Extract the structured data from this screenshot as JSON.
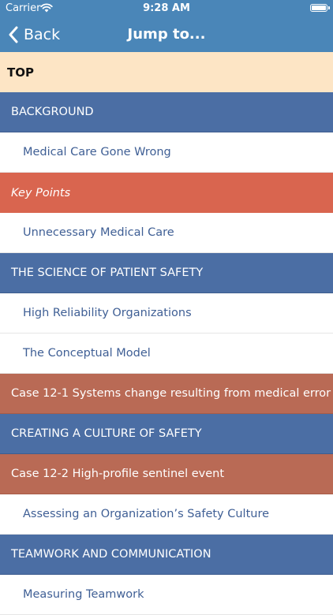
{
  "status_bar": {
    "carrier": "Carrier",
    "time": "9:28 AM",
    "wifi_icon": "wifi-icon",
    "battery_icon": "battery-icon"
  },
  "nav": {
    "back_label": "Back",
    "title": "Jump to...",
    "back_icon": "chevron-left-icon"
  },
  "colors": {
    "header": "#4a86b8",
    "top_row": "#fde5c5",
    "section": "#4b6ea4",
    "subsection_text": "#3f5f95",
    "key_points": "#d9654f",
    "case": "#b96a55"
  },
  "items": [
    {
      "label": "TOP",
      "kind": "top"
    },
    {
      "label": "BACKGROUND",
      "kind": "section"
    },
    {
      "label": "Medical Care Gone Wrong",
      "kind": "subsection"
    },
    {
      "label": "Key Points",
      "kind": "keypoints"
    },
    {
      "label": "Unnecessary Medical Care",
      "kind": "subsection"
    },
    {
      "label": "THE SCIENCE OF PATIENT SAFETY",
      "kind": "section"
    },
    {
      "label": "High Reliability Organizations",
      "kind": "subsection"
    },
    {
      "label": "The Conceptual Model",
      "kind": "subsection"
    },
    {
      "label": "Case 12-1 Systems change resulting from medical error",
      "kind": "case"
    },
    {
      "label": "CREATING A CULTURE OF SAFETY",
      "kind": "section"
    },
    {
      "label": "Case 12-2 High-profile sentinel event",
      "kind": "case"
    },
    {
      "label": "Assessing an Organization’s Safety Culture",
      "kind": "subsection"
    },
    {
      "label": "TEAMWORK AND COMMUNICATION",
      "kind": "section"
    },
    {
      "label": "Measuring Teamwork",
      "kind": "subsection"
    }
  ]
}
